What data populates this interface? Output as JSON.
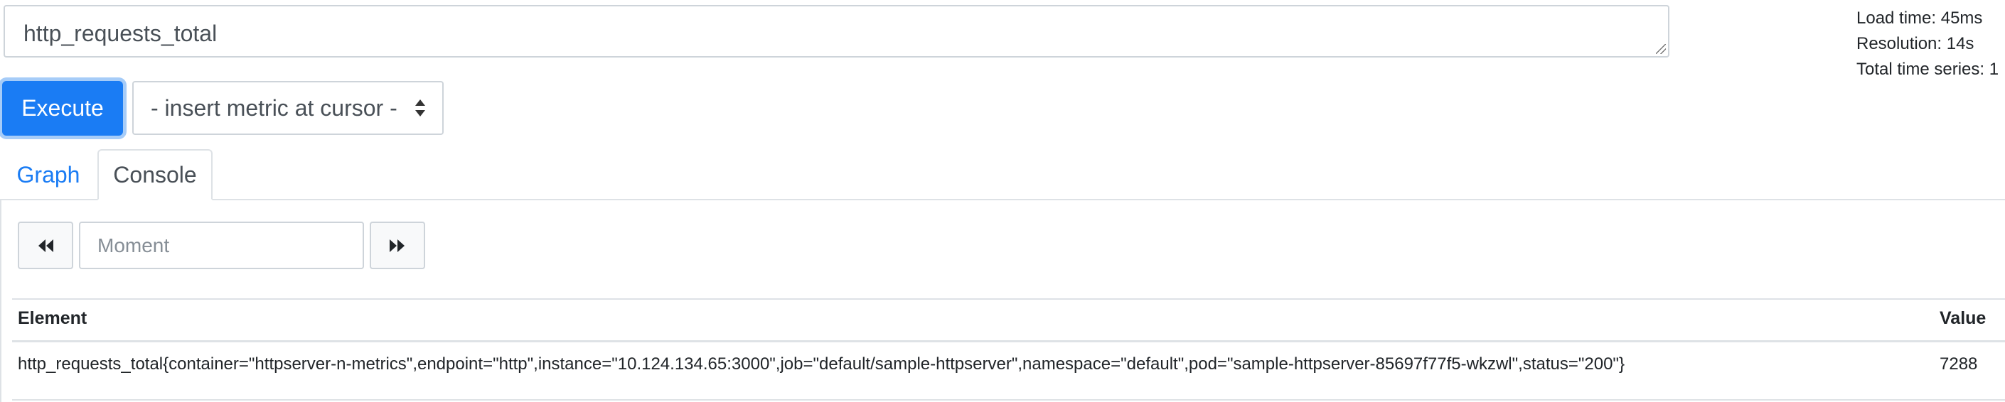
{
  "query": {
    "expression": "http_requests_total"
  },
  "stats": {
    "load_time": "Load time: 45ms",
    "resolution": "Resolution: 14s",
    "total_series": "Total time series: 1"
  },
  "actions": {
    "execute_label": "Execute",
    "metric_select_label": "- insert metric at cursor -"
  },
  "tabs": [
    {
      "label": "Graph",
      "active": false
    },
    {
      "label": "Console",
      "active": true
    }
  ],
  "console": {
    "moment_placeholder": "Moment",
    "prev_icon": "double-chevron-left-icon",
    "next_icon": "double-chevron-right-icon"
  },
  "table": {
    "headers": {
      "element": "Element",
      "value": "Value"
    },
    "rows": [
      {
        "element": "http_requests_total{container=\"httpserver-n-metrics\",endpoint=\"http\",instance=\"10.124.134.65:3000\",job=\"default/sample-httpserver\",namespace=\"default\",pod=\"sample-httpserver-85697f77f5-wkzwl\",status=\"200\"}",
        "value": "7288"
      }
    ]
  },
  "colors": {
    "primary": "#1a7cf4",
    "border": "#ced4da",
    "text": "#212529"
  }
}
